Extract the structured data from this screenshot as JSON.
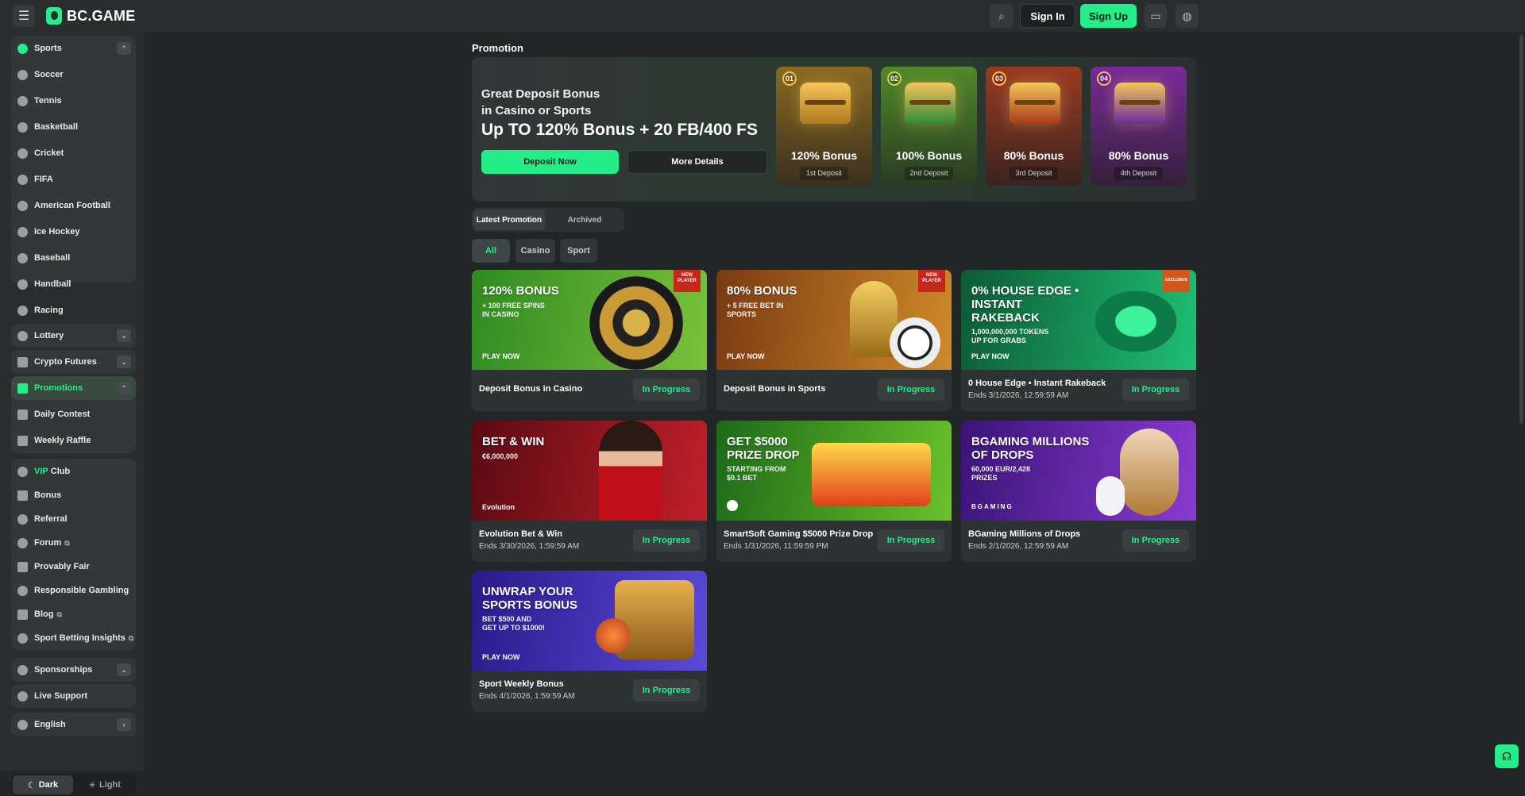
{
  "header": {
    "brand": "BC.GAME",
    "menu_icon": "hamburger-icon",
    "search_icon": "search-icon",
    "sign_in": "Sign In",
    "sign_up": "Sign Up",
    "chat_icon": "chat-icon",
    "language_icon": "globe-icon"
  },
  "sidebar": {
    "sports": "Sports",
    "sport_items": [
      "Soccer",
      "Tennis",
      "Basketball",
      "Cricket",
      "FIFA",
      "American Football",
      "Ice Hockey",
      "Baseball",
      "Handball",
      "Racing"
    ],
    "lottery": "Lottery",
    "crypto_futures": "Crypto Futures",
    "promotions": "Promotions",
    "promo_items": [
      "Daily Contest",
      "Weekly Raffle"
    ],
    "vip_prefix": "VIP",
    "vip_suffix": " Club",
    "links": [
      "Bonus",
      "Referral",
      "Forum",
      "Provably Fair",
      "Responsible Gambling",
      "Blog",
      "Sport Betting Insights"
    ],
    "sponsorships": "Sponsorships",
    "live_support": "Live Support",
    "language": "English",
    "theme_dark": "Dark",
    "theme_light": "Light"
  },
  "main": {
    "title": "Promotion",
    "hero": {
      "line1": "Great Deposit Bonus",
      "line2": "in Casino or Sports",
      "headline": "Up TO 120% Bonus + 20 FB/400 FS",
      "deposit_now": "Deposit Now",
      "more_details": "More Details",
      "tiers": [
        {
          "badge": "01",
          "value": "120% Bonus",
          "label": "1st Deposit",
          "color": "#8a6a1f"
        },
        {
          "badge": "02",
          "value": "100% Bonus",
          "label": "2nd Deposit",
          "color": "#3f7a2a"
        },
        {
          "badge": "03",
          "value": "80% Bonus",
          "label": "3rd Deposit",
          "color": "#8a3a24"
        },
        {
          "badge": "04",
          "value": "80% Bonus",
          "label": "4th Deposit",
          "color": "#6a2a8a"
        }
      ]
    },
    "tabs": [
      "Latest Promotion",
      "Archived"
    ],
    "filters": [
      "All",
      "Casino",
      "Sport"
    ],
    "status_label": "In Progress",
    "cards": [
      {
        "banner_title": "120% BONUS",
        "banner_sub": "+ 100 FREE SPINS\nIN CASINO",
        "play": "PLAY NOW",
        "flag": "NEW\nPLAYER",
        "name": "Deposit Bonus in Casino",
        "ends": ""
      },
      {
        "banner_title": "80% BONUS",
        "banner_sub": "+ 5 FREE BET IN\nSPORTS",
        "play": "PLAY NOW",
        "flag": "NEW\nPLAYER",
        "name": "Deposit Bonus in Sports",
        "ends": ""
      },
      {
        "banner_title": "0% HOUSE EDGE •\nINSTANT\nRAKEBACK",
        "banner_sub": "1,000,000,000 TOKENS\nUP FOR GRABS",
        "play": "PLAY NOW",
        "flag": "EXCLUSIVE",
        "name": "0 House Edge • Instant Rakeback",
        "ends": "Ends 3/1/2026, 12:59:59 AM"
      },
      {
        "banner_title": "BET & WIN",
        "banner_sub": "€6,000,000",
        "play": "Evolution",
        "flag": "",
        "name": "Evolution Bet & Win",
        "ends": "Ends 3/30/2026, 1:59:59 AM"
      },
      {
        "banner_title": "GET $5000\nPRIZE DROP",
        "banner_sub": "STARTING FROM\n$0.1 BET",
        "play": "",
        "flag": "",
        "name": "SmartSoft Gaming $5000 Prize Drop",
        "ends": "Ends 1/31/2026, 11:59:59 PM"
      },
      {
        "banner_title": "BGAMING MILLIONS\nOF DROPS",
        "banner_sub": "60,000 EUR/2,428\nPRIZES",
        "play": "BGAMING",
        "flag": "",
        "name": "BGaming Millions of Drops",
        "ends": "Ends 2/1/2026, 12:59:59 AM"
      },
      {
        "banner_title": "UNWRAP YOUR\nSPORTS BONUS",
        "banner_sub": "BET $500 AND\nGET UP TO $1000!",
        "play": "PLAY NOW",
        "flag": "",
        "name": "Sport Weekly Bonus",
        "ends": "Ends 4/1/2026, 1:59:59 AM"
      }
    ]
  },
  "support_icon": "headset-icon",
  "colors": {
    "accent": "#24ee89",
    "bg": "#232626",
    "panel": "#292d2e"
  }
}
